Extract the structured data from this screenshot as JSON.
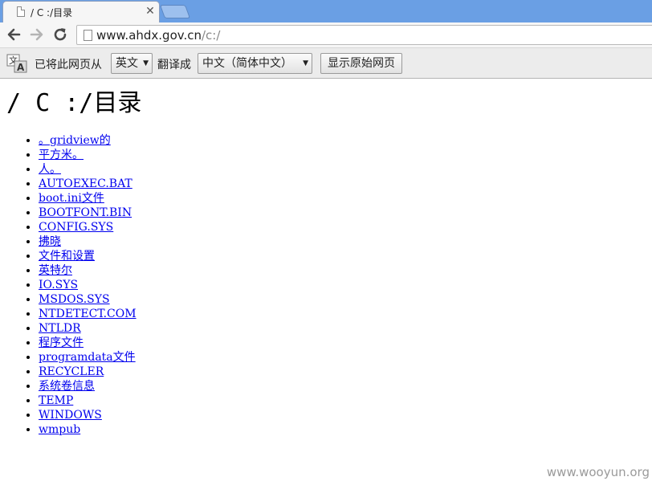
{
  "tab": {
    "title": "/ C :/目录"
  },
  "address_bar": {
    "host": "www.ahdx.gov.cn",
    "path": "/c:/"
  },
  "translate_bar": {
    "prefix_text": "已将此网页从",
    "source_language": "英文",
    "middle_text": "翻译成",
    "target_language": "中文（简体中文）",
    "show_original_label": "显示原始网页"
  },
  "page": {
    "heading": "/ C :/目录",
    "entries": [
      "。gridview的",
      "平方米。",
      "人。",
      "AUTOEXEC.BAT",
      "boot.ini文件",
      "BOOTFONT.BIN",
      "CONFIG.SYS",
      "拂晓",
      "文件和设置",
      "英特尔",
      "IO.SYS",
      "MSDOS.SYS",
      "NTDETECT.COM",
      "NTLDR",
      "程序文件",
      "programdata文件",
      "RECYCLER",
      "系统卷信息",
      "TEMP",
      "WINDOWS",
      "wmpub"
    ]
  },
  "watermark": "www.wooyun.org",
  "colors": {
    "tabstrip": "#6a9fe4",
    "link": "#0000ee",
    "translate_bar": "#ececec"
  },
  "icons": {
    "back": "arrow-left-icon",
    "forward": "arrow-right-icon",
    "reload": "reload-icon",
    "page": "page-icon",
    "translate": "translate-icon",
    "close": "close-icon"
  }
}
